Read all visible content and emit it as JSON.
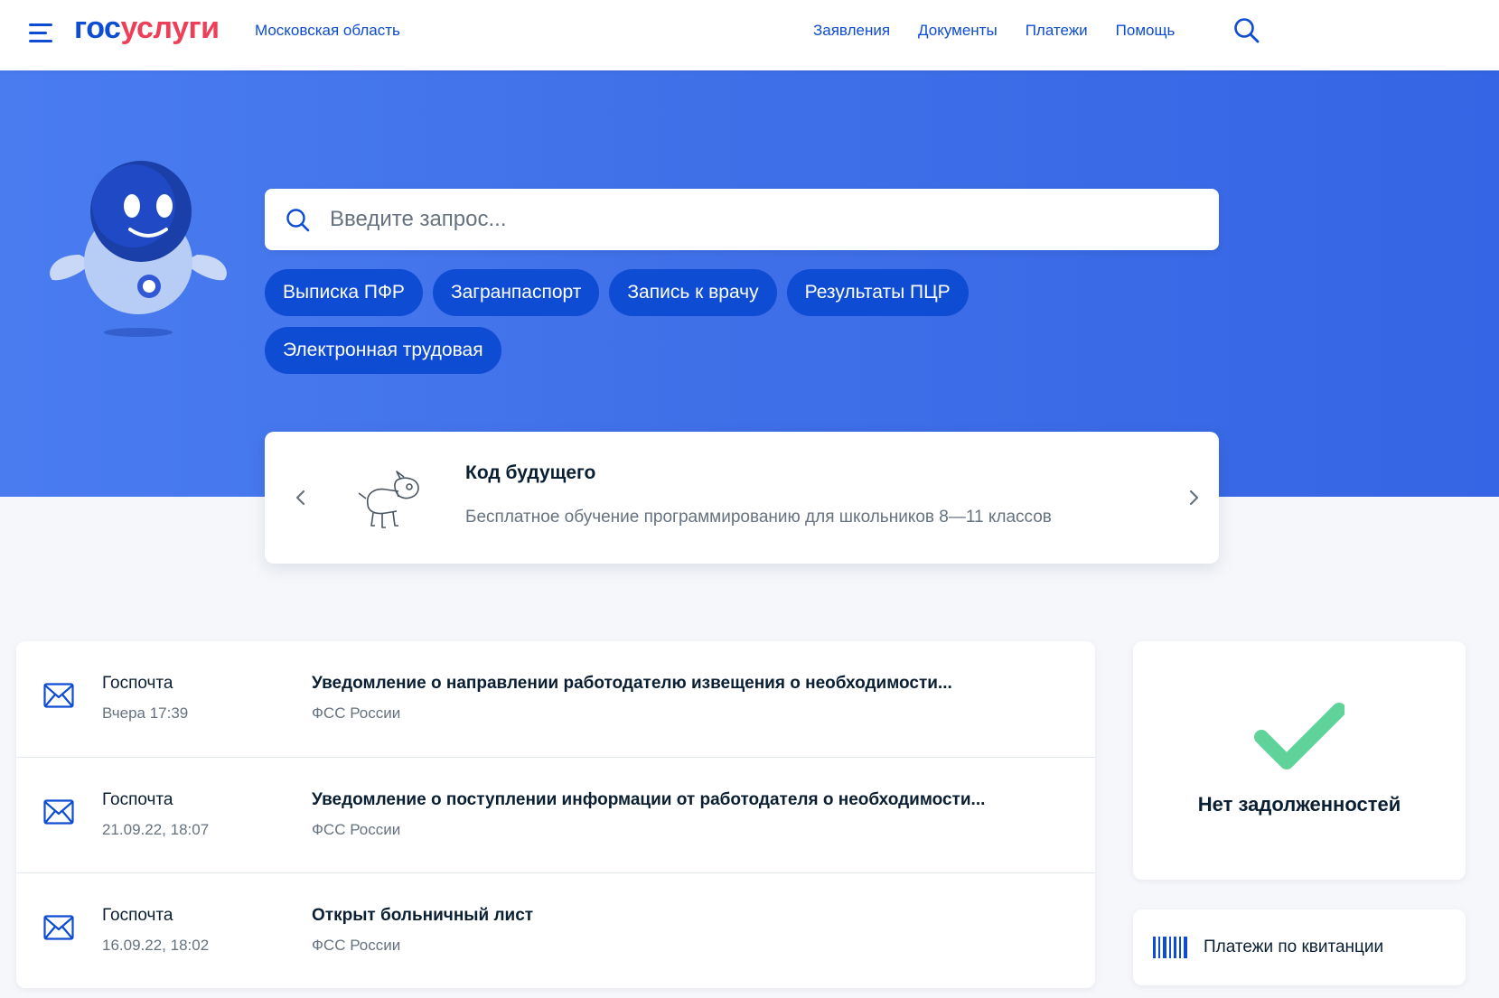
{
  "header": {
    "logo_part1": "гос",
    "logo_part2": "услуги",
    "region": "Московская область",
    "nav": [
      "Заявления",
      "Документы",
      "Платежи",
      "Помощь"
    ]
  },
  "hero": {
    "search_placeholder": "Введите запрос...",
    "chips": [
      "Выписка ПФР",
      "Загранпаспорт",
      "Запись к врачу",
      "Результаты ПЦР",
      "Электронная трудовая"
    ]
  },
  "banner": {
    "title": "Код будущего",
    "subtitle": "Бесплатное обучение программированию для школьников 8—11 классов"
  },
  "mail": [
    {
      "source": "Госпочта",
      "date": "Вчера 17:39",
      "subject": "Уведомление о направлении работодателю извещения о необходимости...",
      "org": "ФСС России"
    },
    {
      "source": "Госпочта",
      "date": "21.09.22, 18:07",
      "subject": "Уведомление о поступлении информации от работодателя о необходимости...",
      "org": "ФСС России"
    },
    {
      "source": "Госпочта",
      "date": "16.09.22, 18:02",
      "subject": "Открыт больничный лист",
      "org": "ФСС России"
    }
  ],
  "debt": {
    "text": "Нет задолженностей"
  },
  "payments": {
    "text": "Платежи по квитанции"
  },
  "colors": {
    "brand_blue": "#0d4cd3",
    "brand_red": "#ee3f58",
    "hero_blue": "#3f6fe8",
    "success_green": "#5fd39a"
  }
}
